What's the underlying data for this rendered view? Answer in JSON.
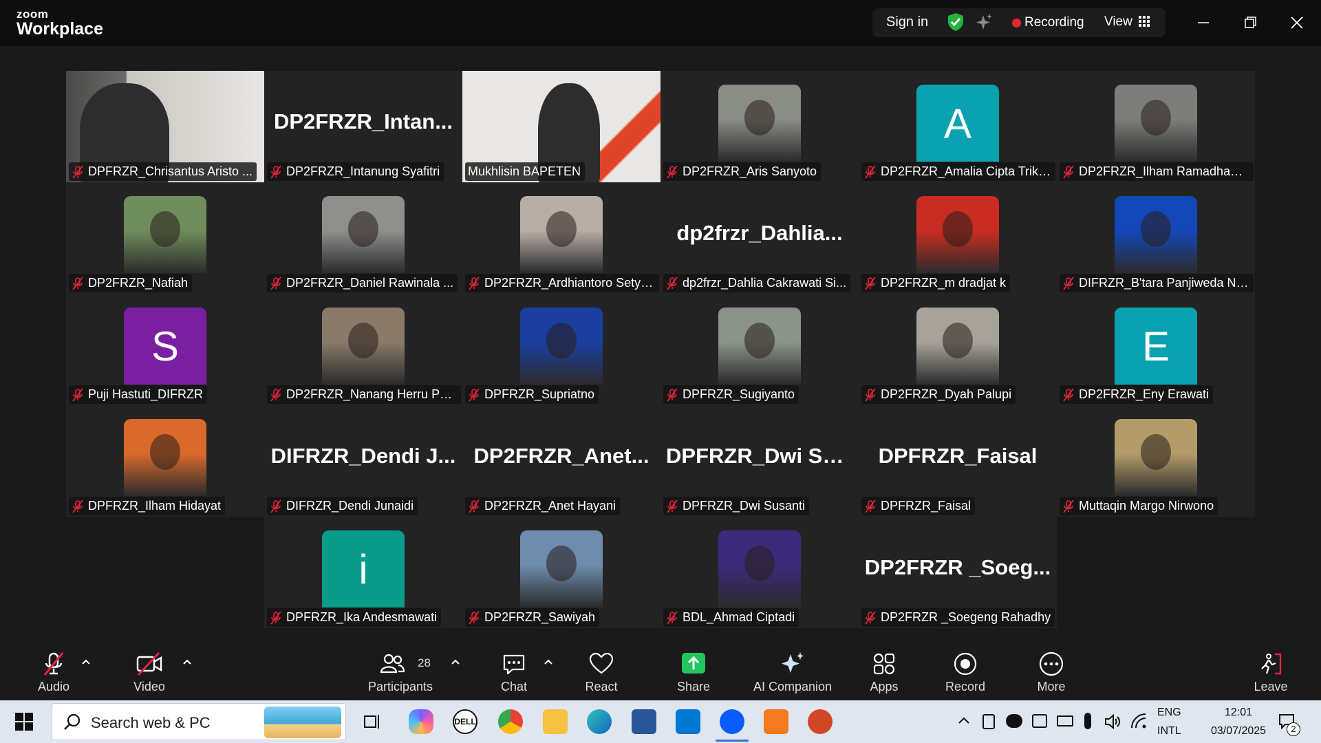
{
  "app": {
    "brand_top": "zoom",
    "brand_bottom": "Workplace"
  },
  "titlebar": {
    "sign_in": "Sign in",
    "recording": "Recording",
    "view": "View"
  },
  "tiles": [
    {
      "col": 0,
      "row": 0,
      "name": "DPFRZR_Chrisantus Aristo ...",
      "kind": "photo",
      "bg": "#c9c6c0"
    },
    {
      "col": 1,
      "row": 0,
      "name": "DP2FRZR_Intanung Syafitri",
      "kind": "text",
      "big": "DP2FRZR_Intan..."
    },
    {
      "col": 2,
      "row": 0,
      "name": "Mukhlisin BAPETEN",
      "kind": "speaker",
      "bg": "#e9e6e3"
    },
    {
      "col": 3,
      "row": 0,
      "name": "DP2FRZR_Aris Sanyoto",
      "kind": "avatar",
      "bg": "#8a8c86"
    },
    {
      "col": 4,
      "row": 0,
      "name": "DP2FRZR_Amalia Cipta Triku...",
      "kind": "letter",
      "letter": "A",
      "bg": "#0aa1b0"
    },
    {
      "col": 5,
      "row": 0,
      "name": "DP2FRZR_Ilham Ramadhan ...",
      "kind": "avatar",
      "bg": "#7d7e7a"
    },
    {
      "col": 0,
      "row": 1,
      "name": "DP2FRZR_Nafiah",
      "kind": "avatar",
      "bg": "#6f8d5c"
    },
    {
      "col": 1,
      "row": 1,
      "name": "DP2FRZR_Daniel Rawinala ...",
      "kind": "avatar",
      "bg": "#8f8f8c"
    },
    {
      "col": 2,
      "row": 1,
      "name": "DP2FRZR_Ardhiantoro Setya...",
      "kind": "avatar",
      "bg": "#b8ada5"
    },
    {
      "col": 3,
      "row": 1,
      "name": "dp2frzr_Dahlia Cakrawati Si...",
      "kind": "text",
      "big": "dp2frzr_Dahlia..."
    },
    {
      "col": 4,
      "row": 1,
      "name": "DP2FRZR_m dradjat k",
      "kind": "avatar",
      "bg": "#c92c23"
    },
    {
      "col": 5,
      "row": 1,
      "name": "DIFRZR_B'tara Panjiweda Nis...",
      "kind": "avatar",
      "bg": "#1447b8"
    },
    {
      "col": 0,
      "row": 2,
      "name": "Puji Hastuti_DIFRZR",
      "kind": "letter",
      "letter": "S",
      "bg": "#7b1fa2"
    },
    {
      "col": 1,
      "row": 2,
      "name": "DP2FRZR_Nanang Herru Pur...",
      "kind": "avatar",
      "bg": "#8a7a6a"
    },
    {
      "col": 2,
      "row": 2,
      "name": "DPFRZR_Supriatno",
      "kind": "avatar",
      "bg": "#1b3fa0"
    },
    {
      "col": 3,
      "row": 2,
      "name": "DPFRZR_Sugiyanto",
      "kind": "avatar",
      "bg": "#8a9389"
    },
    {
      "col": 4,
      "row": 2,
      "name": "DP2FRZR_Dyah Palupi",
      "kind": "avatar",
      "bg": "#a8a399"
    },
    {
      "col": 5,
      "row": 2,
      "name": "DP2FRZR_Eny Erawati",
      "kind": "letter",
      "letter": "E",
      "bg": "#0aa1b0"
    },
    {
      "col": 0,
      "row": 3,
      "name": "DPFRZR_Ilham Hidayat",
      "kind": "avatar",
      "bg": "#d96a2c"
    },
    {
      "col": 1,
      "row": 3,
      "name": "DIFRZR_Dendi Junaidi",
      "kind": "text",
      "big": "DIFRZR_Dendi  J..."
    },
    {
      "col": 2,
      "row": 3,
      "name": "DP2FRZR_Anet Hayani",
      "kind": "text",
      "big": "DP2FRZR_Anet..."
    },
    {
      "col": 3,
      "row": 3,
      "name": "DPFRZR_Dwi Susanti",
      "kind": "text",
      "big": "DPFRZR_Dwi  Su..."
    },
    {
      "col": 4,
      "row": 3,
      "name": "DPFRZR_Faisal",
      "kind": "text",
      "big": "DPFRZR_Faisal"
    },
    {
      "col": 5,
      "row": 3,
      "name": "Muttaqin Margo Nirwono",
      "kind": "avatar",
      "bg": "#b39c6a"
    },
    {
      "col": 1,
      "row": 4,
      "name": "DPFRZR_Ika Andesmawati",
      "kind": "letter",
      "letter": "i",
      "bg": "#0a9c8a"
    },
    {
      "col": 2,
      "row": 4,
      "name": "DP2FRZR_Sawiyah",
      "kind": "avatar",
      "bg": "#6e8cae"
    },
    {
      "col": 3,
      "row": 4,
      "name": "BDL_Ahmad Ciptadi",
      "kind": "avatar",
      "bg": "#3c2a7a"
    },
    {
      "col": 4,
      "row": 4,
      "name": "DP2FRZR _Soegeng Rahadhy",
      "kind": "text",
      "big": "DP2FRZR  _Soeg..."
    }
  ],
  "toolbar": {
    "audio": "Audio",
    "video": "Video",
    "participants": "Participants",
    "participants_count": "28",
    "chat": "Chat",
    "react": "React",
    "share": "Share",
    "ai_companion": "AI Companion",
    "apps": "Apps",
    "record": "Record",
    "more": "More",
    "leave": "Leave"
  },
  "taskbar": {
    "search_placeholder": "Search web & PC",
    "lang_top": "ENG",
    "lang_bottom": "INTL",
    "time": "12:01",
    "date": "03/07/2025",
    "notif_count": "2"
  },
  "colors": {
    "active_speaker": "#23d960",
    "recording": "#e5243b",
    "mute": "#e5243b",
    "share": "#22c55e"
  }
}
